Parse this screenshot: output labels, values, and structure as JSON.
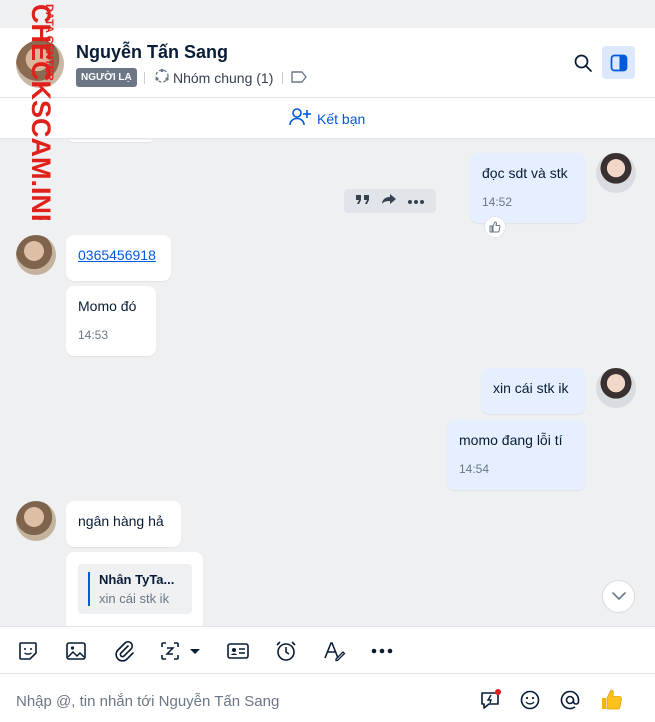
{
  "watermark": {
    "line1": "CHECKSCAM.INFO",
    "line2": "DATA CENTER"
  },
  "header": {
    "contact_name": "Nguyễn Tấn Sang",
    "badge": "NGƯỜI LẠ",
    "group_label": "Nhóm chung (1)",
    "icons": [
      "group-icon",
      "tag-icon",
      "search-icon",
      "sidebar-toggle-icon"
    ]
  },
  "friend_bar": {
    "label": "Kết bạn",
    "icon": "add-user-icon"
  },
  "messages": [
    {
      "sender": "me",
      "text": "đọc sdt và stk",
      "time": "14:52",
      "reaction": "thumbs-up-icon"
    },
    {
      "sender": "other",
      "text": "0365456918",
      "is_link": true
    },
    {
      "sender": "other",
      "text": "Momo đó",
      "time": "14:53"
    },
    {
      "sender": "me",
      "text": "xin cái stk ik"
    },
    {
      "sender": "me",
      "text": "momo đang lỗi tí",
      "time": "14:54"
    },
    {
      "sender": "other",
      "text": "ngân hàng hả"
    },
    {
      "sender": "other",
      "quote_name": "Nhân TyTa...",
      "quote_text": "xin cái stk ik"
    }
  ],
  "message_actions": [
    "quote-icon",
    "forward-icon",
    "more-icon"
  ],
  "toolbar": {
    "icons": [
      "sticker-icon",
      "image-icon",
      "attachment-icon",
      "screenshot-icon",
      "contact-card-icon",
      "reminder-icon",
      "format-text-icon",
      "more-icon"
    ]
  },
  "composer": {
    "placeholder": "Nhập @, tin nhắn tới Nguyễn Tấn Sang",
    "icons": [
      "quick-message-icon",
      "emoji-icon",
      "mention-icon",
      "like-icon"
    ]
  },
  "colors": {
    "accent": "#005ae0",
    "my_bubble": "#e5efff",
    "background": "#eef0f1",
    "watermark": "#e0201b"
  }
}
